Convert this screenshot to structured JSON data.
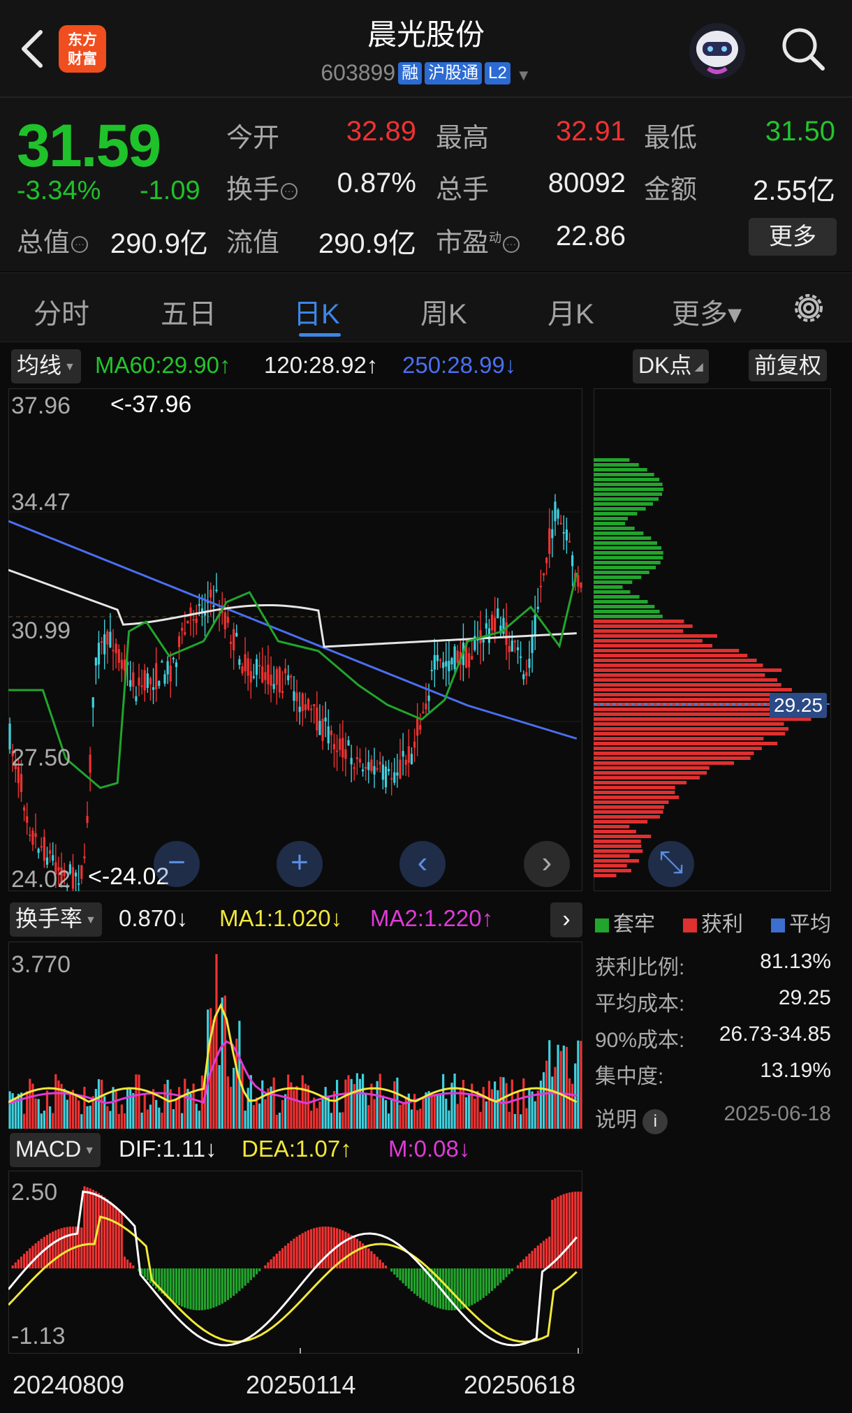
{
  "header": {
    "title": "晨光股份",
    "code": "603899",
    "tags": [
      "融",
      "沪股通",
      "L2"
    ],
    "logo_text": "东方\n财富"
  },
  "quote": {
    "price": "31.59",
    "change_pct": "-3.34%",
    "change": "-1.09",
    "fields": {
      "open_label": "今开",
      "open": "32.89",
      "high_label": "最高",
      "high": "32.91",
      "low_label": "最低",
      "low": "31.50",
      "turnover_label": "换手",
      "turnover": "0.87%",
      "volume_label": "总手",
      "volume": "80092",
      "amount_label": "金额",
      "amount": "2.55亿",
      "mktcap_label": "总值",
      "mktcap": "290.9亿",
      "float_label": "流值",
      "float": "290.9亿",
      "pe_label": "市盈",
      "pe_sup": "动",
      "pe": "22.86"
    },
    "more_label": "更多"
  },
  "tabs": [
    {
      "label": "分时"
    },
    {
      "label": "五日"
    },
    {
      "label": "日K"
    },
    {
      "label": "周K"
    },
    {
      "label": "月K"
    },
    {
      "label": "更多▾"
    }
  ],
  "kline": {
    "selector": "均线",
    "ma60": "MA60:29.90↑",
    "ma120": "120:28.92↑",
    "ma250": "250:28.99↓",
    "dk_label": "DK点",
    "adjust_label": "前复权",
    "y_ticks": [
      "37.96",
      "34.47",
      "30.99",
      "27.50",
      "24.02"
    ],
    "max_marker": "<-37.96",
    "min_marker": "<-24.02",
    "chip_avg_label": "29.25"
  },
  "turnover": {
    "selector": "换手率",
    "value": "0.870↓",
    "ma1": "MA1:1.020↓",
    "ma2": "MA2:1.220↑",
    "y_tick": "3.770"
  },
  "macd": {
    "selector": "MACD",
    "dif": "DIF:1.11↓",
    "dea": "DEA:1.07↑",
    "m": "M:0.08↓",
    "y_top": "2.50",
    "y_bottom": "-1.13"
  },
  "x_axis": [
    "20240809",
    "20250114",
    "20250618"
  ],
  "chips": {
    "legend": [
      "套牢",
      "获利",
      "平均"
    ],
    "rows": [
      {
        "label": "获利比例:",
        "value": "81.13%"
      },
      {
        "label": "平均成本:",
        "value": "29.25"
      },
      {
        "label": "90%成本:",
        "value": "26.73-34.85"
      },
      {
        "label": "集中度:",
        "value": "13.19%"
      }
    ],
    "note_label": "说明",
    "date": "2025-06-18"
  },
  "colors": {
    "up": "#f03232",
    "down": "#22c52c",
    "accent": "#3d86e8",
    "bear_candle": "#3fd1df"
  }
}
